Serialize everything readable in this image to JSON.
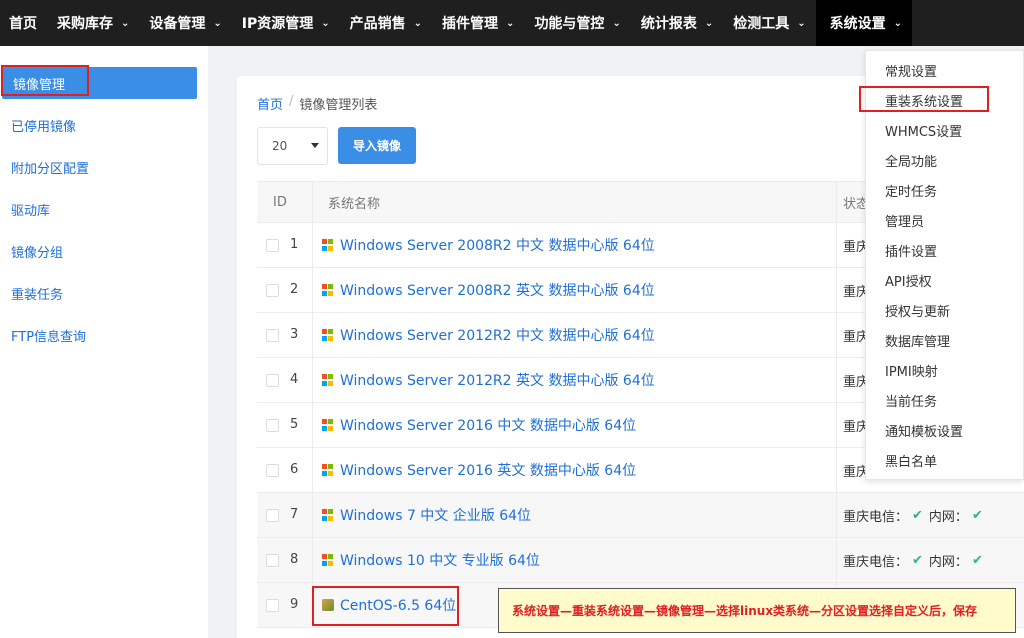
{
  "topnav": {
    "items": [
      {
        "label": "首页",
        "has_menu": false
      },
      {
        "label": "采购库存",
        "has_menu": true
      },
      {
        "label": "设备管理",
        "has_menu": true
      },
      {
        "label": "IP资源管理",
        "has_menu": true
      },
      {
        "label": "产品销售",
        "has_menu": true
      },
      {
        "label": "插件管理",
        "has_menu": true
      },
      {
        "label": "功能与管控",
        "has_menu": true
      },
      {
        "label": "统计报表",
        "has_menu": true
      },
      {
        "label": "检测工具",
        "has_menu": true
      },
      {
        "label": "系统设置",
        "has_menu": true,
        "active": true
      }
    ]
  },
  "sidebar": {
    "items": [
      {
        "label": "镜像管理",
        "active": true
      },
      {
        "label": "已停用镜像"
      },
      {
        "label": "附加分区配置"
      },
      {
        "label": "驱动库"
      },
      {
        "label": "镜像分组"
      },
      {
        "label": "重装任务"
      },
      {
        "label": "FTP信息查询"
      }
    ]
  },
  "breadcrumb": {
    "home": "首页",
    "separator": "/",
    "current": "镜像管理列表"
  },
  "toolbar": {
    "page_size": "20",
    "import_label": "导入镜像"
  },
  "table": {
    "headers": {
      "id": "ID",
      "name": "系统名称",
      "status": "状态"
    },
    "rows": [
      {
        "id": "1",
        "name": "Windows Server 2008R2 中文 数据中心版 64位",
        "os": "windows",
        "status": "重庆"
      },
      {
        "id": "2",
        "name": "Windows Server 2008R2 英文 数据中心版 64位",
        "os": "windows",
        "status": "重庆"
      },
      {
        "id": "3",
        "name": "Windows Server 2012R2 中文 数据中心版 64位",
        "os": "windows",
        "status": "重庆"
      },
      {
        "id": "4",
        "name": "Windows Server 2012R2 英文 数据中心版 64位",
        "os": "windows",
        "status": "重庆"
      },
      {
        "id": "5",
        "name": "Windows Server 2016 中文 数据中心版 64位",
        "os": "windows",
        "status": "重庆"
      },
      {
        "id": "6",
        "name": "Windows Server 2016 英文 数据中心版 64位",
        "os": "windows",
        "status": "重庆"
      },
      {
        "id": "7",
        "name": "Windows 7 中文 企业版 64位",
        "os": "windows",
        "status_a": "重庆电信：",
        "status_b": "内网："
      },
      {
        "id": "8",
        "name": "Windows 10 中文 专业版 64位",
        "os": "windows",
        "status_a": "重庆电信：",
        "status_b": "内网："
      },
      {
        "id": "9",
        "name": "CentOS-6.5 64位",
        "os": "linux",
        "status": ""
      }
    ]
  },
  "dropdown": {
    "items": [
      "常规设置",
      "重装系统设置",
      "WHMCS设置",
      "全局功能",
      "定时任务",
      "管理员",
      "插件设置",
      "API授权",
      "授权与更新",
      "数据库管理",
      "IPMI映射",
      "当前任务",
      "通知模板设置",
      "黑白名单"
    ]
  },
  "note": {
    "text": "系统设置—重装系统设置—镜像管理—选择linux类系统—分区设置选择自定义后，保存"
  },
  "icons": {
    "windows": "windows-logo-icon",
    "linux": "linux-distro-icon",
    "check": "check-icon",
    "chevron": "chevron-down-icon"
  },
  "colors": {
    "accent": "#3a8ee6",
    "link": "#1e6fd9",
    "topbar": "#1f1f1f",
    "highlight": "#e02020",
    "check": "#2eb872",
    "note_bg": "#fffbcc"
  }
}
